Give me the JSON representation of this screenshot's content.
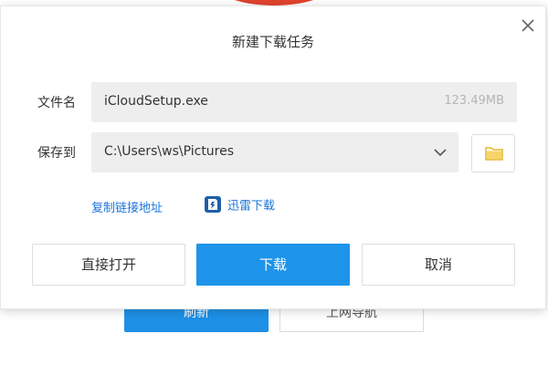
{
  "background": {
    "refresh_label": "刷新",
    "nav_label": "上网导航"
  },
  "dialog": {
    "title": "新建下载任务",
    "filename_label": "文件名",
    "filename_value": "iCloudSetup.exe",
    "filesize": "123.49MB",
    "save_label": "保存到",
    "save_path": "C:\\Users\\ws\\Pictures",
    "copy_link_label": "复制链接地址",
    "thunder_label": "迅雷下载",
    "open_button": "直接打开",
    "download_button": "下载",
    "cancel_button": "取消"
  },
  "colors": {
    "primary": "#1d94ea",
    "link": "#1a73d9",
    "folder": "#f2c443",
    "field_bg": "#eeeeee"
  },
  "icons": {
    "close": "close-icon",
    "dropdown": "chevron-down-icon",
    "folder": "folder-icon",
    "thunder": "thunder-download-icon"
  }
}
